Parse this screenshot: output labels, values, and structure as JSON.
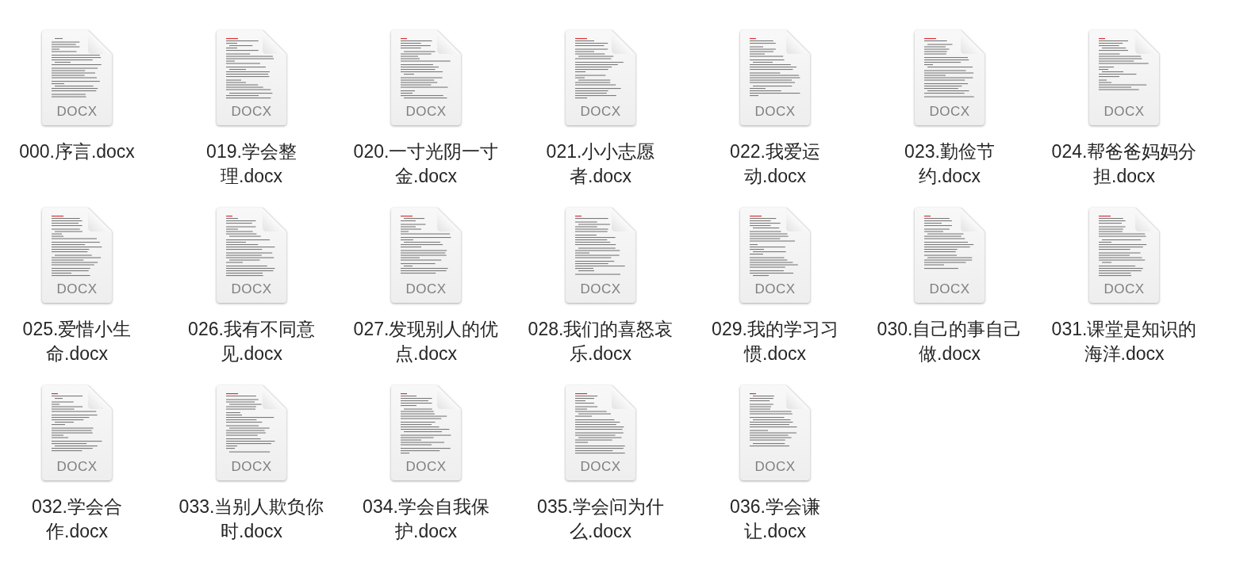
{
  "files": [
    {
      "name": "000.序言.docx",
      "badge": "DOCX"
    },
    {
      "name": "019.学会整理.docx",
      "badge": "DOCX"
    },
    {
      "name": "020.一寸光阴一寸金.docx",
      "badge": "DOCX"
    },
    {
      "name": "021.小小志愿者.docx",
      "badge": "DOCX"
    },
    {
      "name": "022.我爱运动.docx",
      "badge": "DOCX"
    },
    {
      "name": "023.勤俭节约.docx",
      "badge": "DOCX"
    },
    {
      "name": "024.帮爸爸妈妈分担.docx",
      "badge": "DOCX"
    },
    {
      "name": "025.爱惜小生命.docx",
      "badge": "DOCX"
    },
    {
      "name": "026.我有不同意见.docx",
      "badge": "DOCX"
    },
    {
      "name": "027.发现别人的优点.docx",
      "badge": "DOCX"
    },
    {
      "name": "028.我们的喜怒哀乐.docx",
      "badge": "DOCX"
    },
    {
      "name": "029.我的学习习惯.docx",
      "badge": "DOCX"
    },
    {
      "name": "030.自己的事自己做.docx",
      "badge": "DOCX"
    },
    {
      "name": "031.课堂是知识的海洋.docx",
      "badge": "DOCX"
    },
    {
      "name": "032.学会合作.docx",
      "badge": "DOCX"
    },
    {
      "name": "033.当别人欺负你时.docx",
      "badge": "DOCX"
    },
    {
      "name": "034.学会自我保护.docx",
      "badge": "DOCX"
    },
    {
      "name": "035.学会问为什么.docx",
      "badge": "DOCX"
    },
    {
      "name": "036.学会谦让.docx",
      "badge": "DOCX"
    }
  ]
}
